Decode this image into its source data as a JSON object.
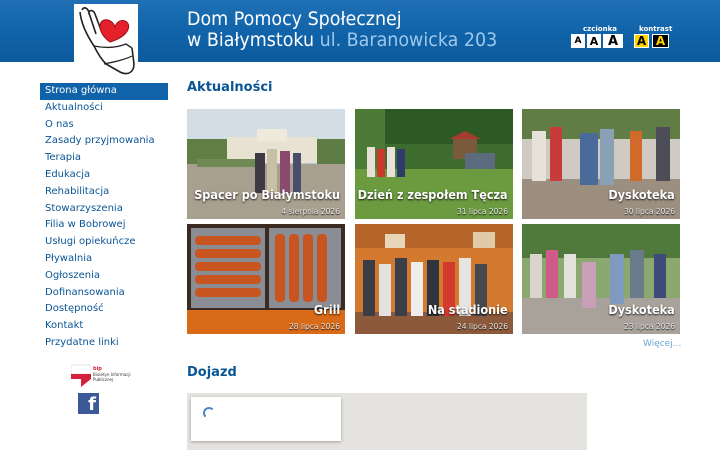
{
  "header": {
    "title_line1": "Dom Pomocy Społecznej",
    "title_line2": "w Białymstoku",
    "address": "ul. Baranowicka 203",
    "font_size_label": "czcionka",
    "contrast_label": "kontrast",
    "font_size_buttons": [
      "A",
      "A",
      "A"
    ],
    "contrast_buttons": [
      "A",
      "A"
    ],
    "colors": {
      "bar": "#1063a8",
      "address": "#9ec8ec"
    }
  },
  "logo": {
    "icon": "heart-in-hand-icon"
  },
  "sidebar": {
    "items": [
      {
        "label": "Strona główna",
        "active": true
      },
      {
        "label": "Aktualności"
      },
      {
        "label": "O nas"
      },
      {
        "label": "Zasady przyjmowania"
      },
      {
        "label": "Terapia"
      },
      {
        "label": "Edukacja"
      },
      {
        "label": "Rehabilitacja"
      },
      {
        "label": "Stowarzyszenia"
      },
      {
        "label": "Filia w Bobrowej"
      },
      {
        "label": "Usługi opiekuńcze"
      },
      {
        "label": "Pływalnia"
      },
      {
        "label": "Ogłoszenia"
      },
      {
        "label": "Dofinansowania"
      },
      {
        "label": "Dostępność"
      },
      {
        "label": "Kontakt"
      },
      {
        "label": "Przydatne linki"
      }
    ],
    "bip_text": "Biuletyn Informacji Publicznej",
    "bip_badge": "bip",
    "facebook_icon": "facebook-icon"
  },
  "news": {
    "title": "Aktualności",
    "tiles": [
      {
        "caption": "Spacer po Białymstoku",
        "date": "4 sierpnia 2026"
      },
      {
        "caption": "Dzień z zespołem Tęcza",
        "date": "31 lipca 2026"
      },
      {
        "caption": "Dyskoteka",
        "date": "30 lipca 2026"
      },
      {
        "caption": "Grill",
        "date": "28 lipca 2026"
      },
      {
        "caption": "Na stadionie",
        "date": "24 lipca 2026"
      },
      {
        "caption": "Dyskoteka",
        "date": "23 lipca 2026"
      }
    ],
    "more_label": "Więcej..."
  },
  "directions": {
    "title": "Dojazd",
    "loading_icon": "loading-spinner-icon"
  }
}
